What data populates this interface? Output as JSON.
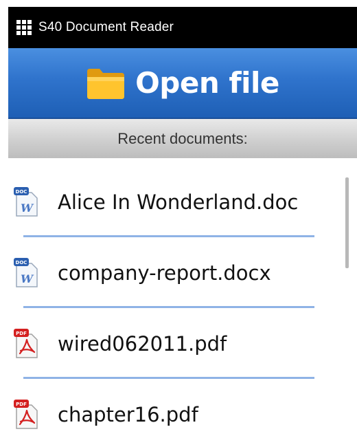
{
  "status_bar": {
    "app_name": "S40 Document Reader",
    "menu_icon": "grid-menu-icon"
  },
  "header": {
    "title": "Open file",
    "icon": "folder-icon"
  },
  "section": {
    "title": "Recent documents:"
  },
  "documents": [
    {
      "name": "Alice In Wonderland.doc",
      "type": "doc",
      "icon": "word-doc-icon"
    },
    {
      "name": "company-report.docx",
      "type": "doc",
      "icon": "word-doc-icon"
    },
    {
      "name": "wired062011.pdf",
      "type": "pdf",
      "icon": "pdf-icon"
    },
    {
      "name": "chapter16.pdf",
      "type": "pdf",
      "icon": "pdf-icon"
    }
  ],
  "colors": {
    "header_blue": "#2f73cc",
    "divider_blue": "#8fb3e6",
    "pdf_red": "#d42020",
    "doc_blue": "#2b5fb0"
  }
}
